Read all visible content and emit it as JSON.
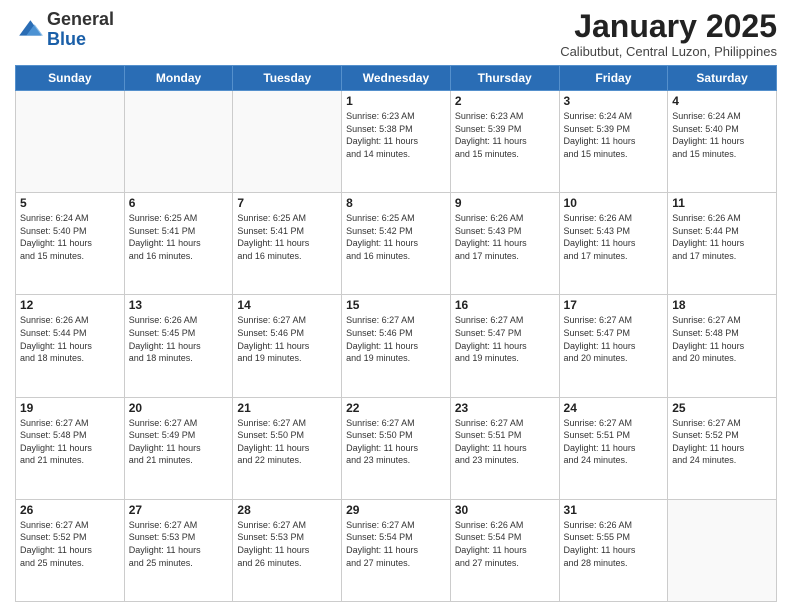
{
  "logo": {
    "general": "General",
    "blue": "Blue"
  },
  "header": {
    "month": "January 2025",
    "location": "Calibutbut, Central Luzon, Philippines"
  },
  "weekdays": [
    "Sunday",
    "Monday",
    "Tuesday",
    "Wednesday",
    "Thursday",
    "Friday",
    "Saturday"
  ],
  "weeks": [
    [
      {
        "day": "",
        "info": ""
      },
      {
        "day": "",
        "info": ""
      },
      {
        "day": "",
        "info": ""
      },
      {
        "day": "1",
        "info": "Sunrise: 6:23 AM\nSunset: 5:38 PM\nDaylight: 11 hours\nand 14 minutes."
      },
      {
        "day": "2",
        "info": "Sunrise: 6:23 AM\nSunset: 5:39 PM\nDaylight: 11 hours\nand 15 minutes."
      },
      {
        "day": "3",
        "info": "Sunrise: 6:24 AM\nSunset: 5:39 PM\nDaylight: 11 hours\nand 15 minutes."
      },
      {
        "day": "4",
        "info": "Sunrise: 6:24 AM\nSunset: 5:40 PM\nDaylight: 11 hours\nand 15 minutes."
      }
    ],
    [
      {
        "day": "5",
        "info": "Sunrise: 6:24 AM\nSunset: 5:40 PM\nDaylight: 11 hours\nand 15 minutes."
      },
      {
        "day": "6",
        "info": "Sunrise: 6:25 AM\nSunset: 5:41 PM\nDaylight: 11 hours\nand 16 minutes."
      },
      {
        "day": "7",
        "info": "Sunrise: 6:25 AM\nSunset: 5:41 PM\nDaylight: 11 hours\nand 16 minutes."
      },
      {
        "day": "8",
        "info": "Sunrise: 6:25 AM\nSunset: 5:42 PM\nDaylight: 11 hours\nand 16 minutes."
      },
      {
        "day": "9",
        "info": "Sunrise: 6:26 AM\nSunset: 5:43 PM\nDaylight: 11 hours\nand 17 minutes."
      },
      {
        "day": "10",
        "info": "Sunrise: 6:26 AM\nSunset: 5:43 PM\nDaylight: 11 hours\nand 17 minutes."
      },
      {
        "day": "11",
        "info": "Sunrise: 6:26 AM\nSunset: 5:44 PM\nDaylight: 11 hours\nand 17 minutes."
      }
    ],
    [
      {
        "day": "12",
        "info": "Sunrise: 6:26 AM\nSunset: 5:44 PM\nDaylight: 11 hours\nand 18 minutes."
      },
      {
        "day": "13",
        "info": "Sunrise: 6:26 AM\nSunset: 5:45 PM\nDaylight: 11 hours\nand 18 minutes."
      },
      {
        "day": "14",
        "info": "Sunrise: 6:27 AM\nSunset: 5:46 PM\nDaylight: 11 hours\nand 19 minutes."
      },
      {
        "day": "15",
        "info": "Sunrise: 6:27 AM\nSunset: 5:46 PM\nDaylight: 11 hours\nand 19 minutes."
      },
      {
        "day": "16",
        "info": "Sunrise: 6:27 AM\nSunset: 5:47 PM\nDaylight: 11 hours\nand 19 minutes."
      },
      {
        "day": "17",
        "info": "Sunrise: 6:27 AM\nSunset: 5:47 PM\nDaylight: 11 hours\nand 20 minutes."
      },
      {
        "day": "18",
        "info": "Sunrise: 6:27 AM\nSunset: 5:48 PM\nDaylight: 11 hours\nand 20 minutes."
      }
    ],
    [
      {
        "day": "19",
        "info": "Sunrise: 6:27 AM\nSunset: 5:48 PM\nDaylight: 11 hours\nand 21 minutes."
      },
      {
        "day": "20",
        "info": "Sunrise: 6:27 AM\nSunset: 5:49 PM\nDaylight: 11 hours\nand 21 minutes."
      },
      {
        "day": "21",
        "info": "Sunrise: 6:27 AM\nSunset: 5:50 PM\nDaylight: 11 hours\nand 22 minutes."
      },
      {
        "day": "22",
        "info": "Sunrise: 6:27 AM\nSunset: 5:50 PM\nDaylight: 11 hours\nand 23 minutes."
      },
      {
        "day": "23",
        "info": "Sunrise: 6:27 AM\nSunset: 5:51 PM\nDaylight: 11 hours\nand 23 minutes."
      },
      {
        "day": "24",
        "info": "Sunrise: 6:27 AM\nSunset: 5:51 PM\nDaylight: 11 hours\nand 24 minutes."
      },
      {
        "day": "25",
        "info": "Sunrise: 6:27 AM\nSunset: 5:52 PM\nDaylight: 11 hours\nand 24 minutes."
      }
    ],
    [
      {
        "day": "26",
        "info": "Sunrise: 6:27 AM\nSunset: 5:52 PM\nDaylight: 11 hours\nand 25 minutes."
      },
      {
        "day": "27",
        "info": "Sunrise: 6:27 AM\nSunset: 5:53 PM\nDaylight: 11 hours\nand 25 minutes."
      },
      {
        "day": "28",
        "info": "Sunrise: 6:27 AM\nSunset: 5:53 PM\nDaylight: 11 hours\nand 26 minutes."
      },
      {
        "day": "29",
        "info": "Sunrise: 6:27 AM\nSunset: 5:54 PM\nDaylight: 11 hours\nand 27 minutes."
      },
      {
        "day": "30",
        "info": "Sunrise: 6:26 AM\nSunset: 5:54 PM\nDaylight: 11 hours\nand 27 minutes."
      },
      {
        "day": "31",
        "info": "Sunrise: 6:26 AM\nSunset: 5:55 PM\nDaylight: 11 hours\nand 28 minutes."
      },
      {
        "day": "",
        "info": ""
      }
    ]
  ]
}
